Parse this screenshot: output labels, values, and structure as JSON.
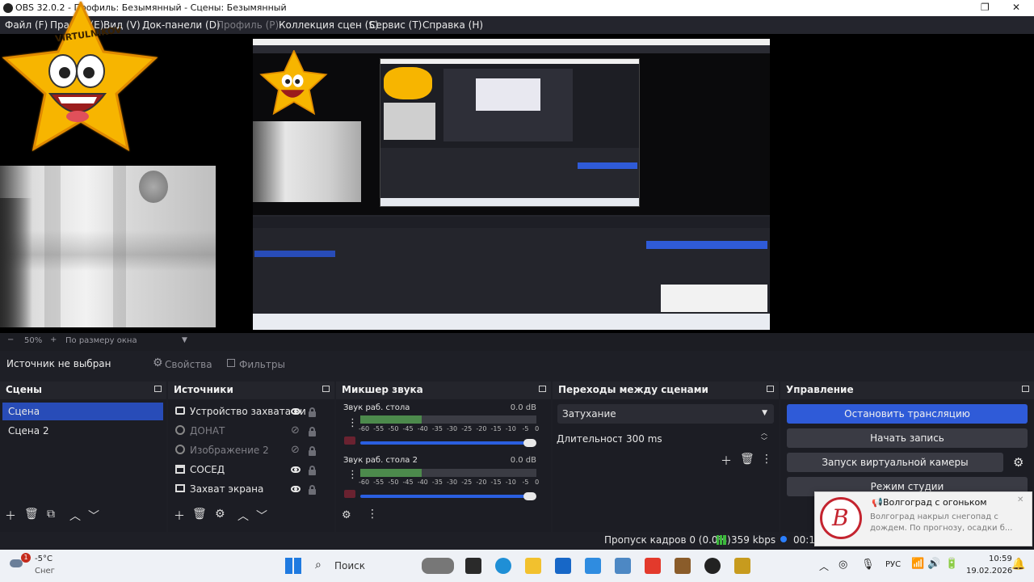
{
  "window": {
    "title": "OBS 32.0.2 - Профиль: Безымянный - Сцены: Безымянный",
    "restore_icon": "restore-icon",
    "close_icon": "close-icon"
  },
  "menu": [
    {
      "label": "Файл (F)",
      "enabled": true
    },
    {
      "label": "Правка (E)",
      "enabled": true
    },
    {
      "label": "Вид (V)",
      "enabled": true
    },
    {
      "label": "Док-панели (D)",
      "enabled": true
    },
    {
      "label": "Профиль (P)",
      "enabled": false
    },
    {
      "label": "Коллекция сцен (S)",
      "enabled": true
    },
    {
      "label": "Сервис (T)",
      "enabled": true
    },
    {
      "label": "Справка (H)",
      "enabled": true
    }
  ],
  "preview": {
    "star_text": "VIRTULNIKOV",
    "zoom_minus": "−",
    "zoom_value": "50%",
    "zoom_plus": "+",
    "zoom_mode": "По размеру окна"
  },
  "source_bar": {
    "no_source": "Источник не выбран",
    "properties_label": "Свойства",
    "filters_label": "Фильтры"
  },
  "scenes": {
    "title": "Сцены",
    "items": [
      {
        "label": "Сцена",
        "selected": true
      },
      {
        "label": "Сцена 2",
        "selected": false
      }
    ]
  },
  "sources": {
    "title": "Источники",
    "items": [
      {
        "label": "Устройство захвата ви",
        "icon": "camera-icon",
        "visible": true,
        "dim": false
      },
      {
        "label": "ДОНАТ",
        "icon": "globe-icon",
        "visible": false,
        "dim": true
      },
      {
        "label": "Изображение 2",
        "icon": "image-icon",
        "visible": false,
        "dim": true
      },
      {
        "label": "СОСЕД",
        "icon": "window-capture-icon",
        "visible": true,
        "dim": false
      },
      {
        "label": "Захват экрана",
        "icon": "monitor-icon",
        "visible": true,
        "dim": false
      }
    ]
  },
  "mixer": {
    "title": "Микшер звука",
    "channels": [
      {
        "name": "Звук раб. стола",
        "db": "0.0 dB",
        "level": 0.35
      },
      {
        "name": "Звук раб. стола 2",
        "db": "0.0 dB",
        "level": 0.35
      }
    ],
    "scale": [
      "-60",
      "-55",
      "-50",
      "-45",
      "-40",
      "-35",
      "-30",
      "-25",
      "-20",
      "-15",
      "-10",
      "-5",
      "0"
    ]
  },
  "transitions": {
    "title": "Переходы между сценами",
    "selected": "Затухание",
    "duration_label": "Длительность",
    "duration_value": "300 ms"
  },
  "controls": {
    "title": "Управление",
    "stop_stream": "Остановить трансляцию",
    "start_record": "Начать запись",
    "virtual_camera": "Запуск виртуальной камеры",
    "studio_mode": "Режим студии"
  },
  "status": {
    "dropped_frames": "Пропуск кадров 0 (0.0%)",
    "bitrate": "359 kbps",
    "time": "00:12"
  },
  "notification": {
    "title": "Волгоград с огоньком",
    "text": "Волгоград накрыл снегопад с дождем. По прогнозу, осадки б..."
  },
  "taskbar": {
    "weather_temp": "-5°C",
    "weather_desc": "Снег",
    "weather_badge": "1",
    "search_placeholder": "Поиск",
    "lang": "РУС",
    "time": "10:59",
    "date": "19.02.2026"
  },
  "colors": {
    "accent": "#2f5bd8",
    "selection": "#284cb8",
    "dock_bg": "#24252c",
    "meter_green": "#4c8a4c"
  }
}
